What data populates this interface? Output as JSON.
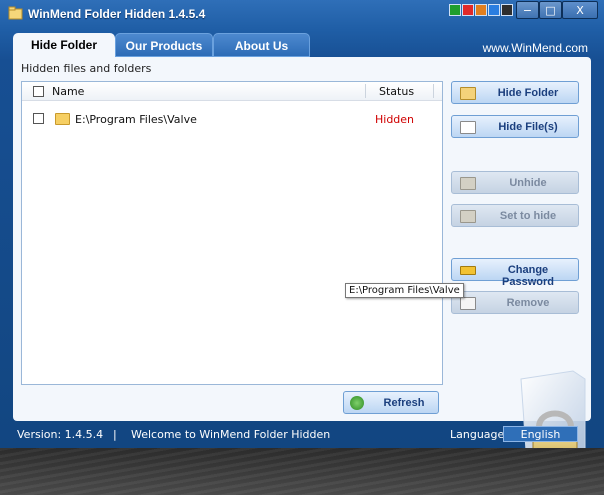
{
  "window": {
    "title": "WinMend Folder Hidden 1.4.5.4",
    "title_colors": [
      "#1f9e2e",
      "#e02a2a",
      "#e07f1f",
      "#2a7ee0",
      "#2e2e2e"
    ],
    "controls": {
      "minimize": "−",
      "maximize": "□",
      "close": "X"
    }
  },
  "tabs": [
    {
      "label": "Hide Folder",
      "active": true
    },
    {
      "label": "Our Products",
      "active": false
    },
    {
      "label": "About Us",
      "active": false
    }
  ],
  "website": "www.WinMend.com",
  "section_label": "Hidden files and folders",
  "list": {
    "columns": {
      "name": "Name",
      "status": "Status"
    },
    "rows": [
      {
        "path": "E:\\Program Files\\Valve",
        "status": "Hidden",
        "icon": "folder-icon"
      }
    ]
  },
  "buttons": {
    "hide_folder": "Hide Folder",
    "hide_files": "Hide File(s)",
    "unhide": "Unhide",
    "set_to_hide": "Set to hide",
    "change_password": "Change Password",
    "remove": "Remove",
    "refresh": "Refresh"
  },
  "tooltip": "E:\\Program Files\\Valve",
  "statusbar": {
    "version": "Version: 1.4.5.4",
    "separator": "|",
    "welcome": "Welcome to WinMend Folder Hidden",
    "language_label": "Language:",
    "language_value": "English"
  },
  "accent_colors": {
    "status_hidden": "#d00000",
    "window_blue": "#1f5ea6"
  }
}
